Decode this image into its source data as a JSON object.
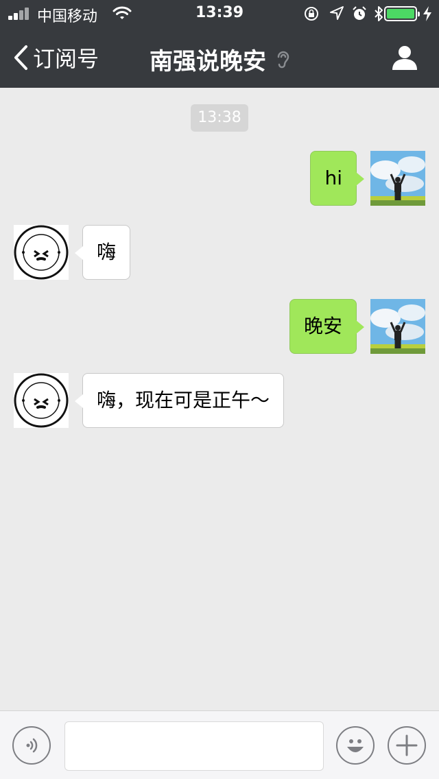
{
  "status_bar": {
    "carrier": "中国移动",
    "time": "13:39",
    "battery_level": 1.0,
    "icons": [
      "signal-icon",
      "wifi-icon",
      "orientation-lock-icon",
      "location-icon",
      "alarm-icon",
      "bluetooth-icon",
      "battery-icon",
      "charging-icon"
    ]
  },
  "nav": {
    "back_label": "订阅号",
    "title": "南强说晚安",
    "icons": [
      "chevron-left-icon",
      "ear-icon",
      "profile-icon"
    ]
  },
  "chat": {
    "timestamp": "13:38",
    "messages": [
      {
        "sender": "me",
        "text": "hi"
      },
      {
        "sender": "bot",
        "text": "嗨"
      },
      {
        "sender": "me",
        "text": "晚安"
      },
      {
        "sender": "bot",
        "text": "嗨，现在可是正午～"
      }
    ]
  },
  "input_bar": {
    "value": "",
    "icons": [
      "voice-icon",
      "emoji-icon",
      "plus-icon"
    ]
  },
  "colors": {
    "nav_bg": "#373a3e",
    "chat_bg": "#ebebeb",
    "my_bubble": "#a0e75a",
    "other_bubble": "#ffffff",
    "battery": "#4cd964"
  }
}
